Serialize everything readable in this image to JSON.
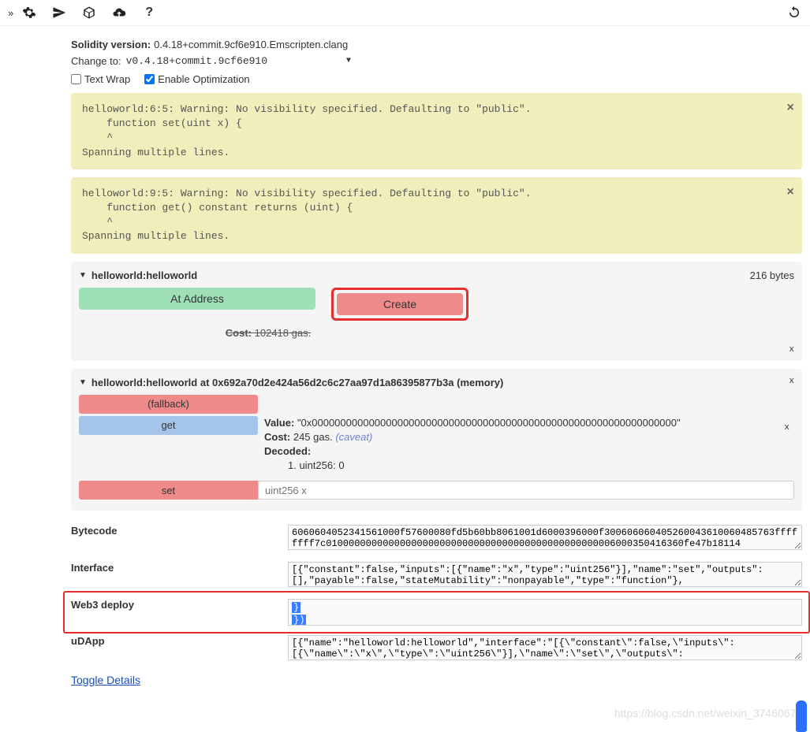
{
  "topbar": {
    "expand": "»"
  },
  "compiler": {
    "version_label": "Solidity version:",
    "version": "0.4.18+commit.9cf6e910.Emscripten.clang",
    "change_to_label": "Change to:",
    "selected_version": "v0.4.18+commit.9cf6e910",
    "text_wrap_label": "Text Wrap",
    "enable_opt_label": "Enable Optimization"
  },
  "warnings": [
    {
      "line1": "helloworld:6:5: Warning: No visibility specified. Defaulting to \"public\".",
      "line2": "    function set(uint x) {",
      "line3": "    ^",
      "line4": "Spanning multiple lines."
    },
    {
      "line1": "helloworld:9:5: Warning: No visibility specified. Defaulting to \"public\".",
      "line2": "    function get() constant returns (uint) {",
      "line3": "    ^",
      "line4": "Spanning multiple lines."
    }
  ],
  "contract": {
    "triangle": "▼",
    "name": "helloworld:helloworld",
    "size": "216 bytes",
    "at_address_label": "At Address",
    "create_label": "Create",
    "cost_label": "Cost:",
    "cost_value": "102418 gas.",
    "close": "x"
  },
  "instance": {
    "triangle": "▼",
    "title": "helloworld:helloworld at 0x692a70d2e424a56d2c6c27aa97d1a86395877b3a (memory)",
    "fallback_label": "(fallback)",
    "get_label": "get",
    "set_label": "set",
    "set_placeholder": "uint256 x",
    "value_label": "Value:",
    "value": "\"0x0000000000000000000000000000000000000000000000000000000000000000\"",
    "cost_label": "Cost:",
    "cost_value": "245 gas.",
    "caveat": "(caveat)",
    "decoded_label": "Decoded:",
    "decoded_item": "1. uint256: 0",
    "close": "x"
  },
  "details": {
    "bytecode_label": "Bytecode",
    "bytecode_value": "6060604052341561000f57600080fd5b60bb8061001d6000396000f300606060405260043610060485763ffffffff7c010000000000000000000000000000000000000000000000006000350416360fe47b18114",
    "interface_label": "Interface",
    "interface_value": "[{\"constant\":false,\"inputs\":[{\"name\":\"x\",\"type\":\"uint256\"}],\"name\":\"set\",\"outputs\":[],\"payable\":false,\"stateMutability\":\"nonpayable\",\"type\":\"function\"},",
    "web3_label": "Web3 deploy",
    "web3_sel1": "   }",
    "web3_sel2": " })",
    "udapp_label": "uDApp",
    "udapp_value": "[{\"name\":\"helloworld:helloworld\",\"interface\":\"[{\\\"constant\\\":false,\\\"inputs\\\":[{\\\"name\\\":\\\"x\\\",\\\"type\\\":\\\"uint256\\\"}],\\\"name\\\":\\\"set\\\",\\\"outputs\\\":",
    "toggle_label": "Toggle Details"
  },
  "watermark": "https://blog.csdn.net/weixin_37460672"
}
